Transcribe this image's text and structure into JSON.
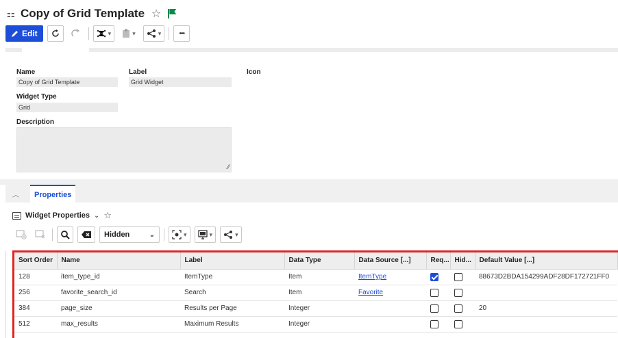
{
  "header": {
    "title": "Copy of Grid Template",
    "grid_icon": "⚏",
    "star_icon": "☆"
  },
  "toolbar": {
    "edit_label": "Edit",
    "more_label": "•••"
  },
  "form": {
    "name_label": "Name",
    "name_value": "Copy of Grid Template",
    "label_label": "Label",
    "label_value": "Grid Widget",
    "icon_label": "Icon",
    "widget_type_label": "Widget Type",
    "widget_type_value": "Grid",
    "description_label": "Description"
  },
  "section": {
    "tab_label": "Properties"
  },
  "widget_properties": {
    "title": "Widget Properties"
  },
  "grid_toolbar": {
    "filter_value": "Hidden"
  },
  "table": {
    "columns": [
      "Sort Order",
      "Name",
      "Label",
      "Data Type",
      "Data Source [...]",
      "Req...",
      "Hid...",
      "Default Value [...]"
    ],
    "rows": [
      {
        "sort_order": "128",
        "name": "item_type_id",
        "label": "ItemType",
        "data_type": "Item",
        "data_source": "ItemType",
        "required": true,
        "hidden": false,
        "default_value": "88673D2BDA154299ADF28DF172721FF0"
      },
      {
        "sort_order": "256",
        "name": "favorite_search_id",
        "label": "Search",
        "data_type": "Item",
        "data_source": "Favorite",
        "required": false,
        "hidden": false,
        "default_value": ""
      },
      {
        "sort_order": "384",
        "name": "page_size",
        "label": "Results per Page",
        "data_type": "Integer",
        "data_source": "",
        "required": false,
        "hidden": false,
        "default_value": "20"
      },
      {
        "sort_order": "512",
        "name": "max_results",
        "label": "Maximum Results",
        "data_type": "Integer",
        "data_source": "",
        "required": false,
        "hidden": false,
        "default_value": ""
      }
    ]
  },
  "colors": {
    "accent": "#1d4ed8",
    "highlight_border": "#e02424",
    "flag": "#0a8a4a"
  }
}
